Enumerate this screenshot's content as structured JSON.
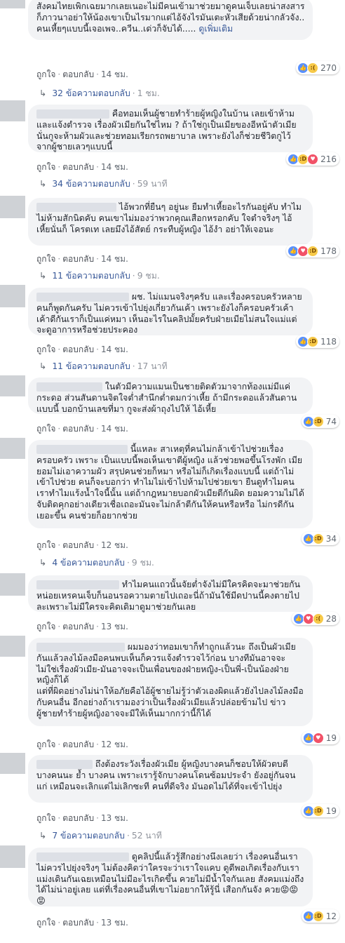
{
  "labels": {
    "like": "ถูกใจ",
    "reply": "ตอบกลับ",
    "dot": "·"
  },
  "comments": [
    {
      "text": "สังคมไทยเพิกเฉยมากเลยเนอะไม่มีคนเข้ามาช่วยมาดูคนเจ็บเลยน่าสงสาร\nก็ภาวนาอย่าให้น้องเขาเป็นไรมากแต่ไอ้จังไรมันเตะหัวเสียด้วยน่ากลัวจัง..\nคนเหี้ยๆแบบนี้เจอเพจ..ควีน..เด่วก็จับได้.....",
      "see_more": "ดูเพิ่มเติม",
      "time": "14 ชม.",
      "reactions": [
        "like",
        "sad"
      ],
      "reaction_count": "270",
      "replies": "32 ข้อความตอบกลับ",
      "replies_time": "1 ชม."
    },
    {
      "text": "คือทอมเห็นผู้ชายทำร้ายผู้หญิงในบ้าน เลยเข้าห้ามและแจ้งตำรวจ เรื่องผัวเมียกันใช่ไหม ? ถ้าใช่กูเป็นเมียของอีหน้าตัวเมียนั่นกูจะห้ามผัวและช่วยทอมเรียกรถพยาบาล เพราะยังไงก็ช่วยชีวิตกูไว้จากผู้ชายเลวๆแบบนี้",
      "time": "14 ชม.",
      "reactions": [
        "like",
        "haha",
        "love"
      ],
      "reaction_count": "216",
      "replies": "34 ข้อความตอบกลับ",
      "replies_time": "59 นาที"
    },
    {
      "text": "ไอ้พวกที่ยืนๆ อยู่นะ ยืมทำเหี้ยอะไรกันอยู่คับ ทำไมไม่ห้ามสักนิดคับ คนเขาไม่มองว่าพวกคุณเสือกหรอกคับ ใจตำจริงๆ ไอ้เหี้ยนั่นก็ โครตเท เลยมึงไอ้สัตย์ กระทืบผู้หญิง ไอ้งำ อย่าให้เจอนะ",
      "time": "14 ชม.",
      "reactions": [
        "like",
        "love",
        "haha"
      ],
      "reaction_count": "178",
      "replies": "11 ข้อความตอบกลับ",
      "replies_time": "9 ชม."
    },
    {
      "text": "ผช. ไม่แมนจริงๆครับ และเรื่องครอบครัวหลายคนก็พูดกันครับ ไม่ควรเข้าไปยุ่งเกี่ยวกันเค้า เพราะยังไงก็ครอบครัวเค้า เค้าดีกันเราก็เป็นแค่หมา เห็นอะไรในคลิปมั้ยครับฝ่ายเมียไม่สนใจแม่แต่จะดูอาการหรือช่วยประคอง",
      "time": "14 ชม.",
      "reactions": [
        "like",
        "haha"
      ],
      "reaction_count": "118",
      "replies": "11 ข้อความตอบกลับ",
      "replies_time": "17 นาที"
    },
    {
      "text": "ในตัวมีความแมนเป็นชายติดตัวมาจากท้องแม่มีแค่กระดอ ส่วนสันดานจิตใจต่ำสำนึกต่ำตมกว่าเหี้ย ถ้ามีกระดอแล้วสันดานแบบนี้ บอกบ้านเลขที่มา กูจะส่งผ้าถุงไปให้ ไอ้เหี้ย",
      "time": "14 ชม.",
      "reactions": [
        "like",
        "haha"
      ],
      "reaction_count": "74"
    },
    {
      "text": "นี้แหละ สาเหตุที่คนไม่กล้าเข้าไปช่วยเรื่องครอบครัว เพราะ เป็นแบบนี้พอเห็นเขาตีผู้หญิง แล้วช่วยพอขึ้นโรงพัก เมียยอมไม่เอาความผัว สรุปคนช่วยก็หมา หรือไม่ก็เกิดเรื่องแบบนี้ แต่ถ้าไม่เข้าไปช่วย คนก็จะบอกว่า ทำไมไม่เข้าไปห้ามไปช่วยเขา ยืนดูทำไมคนเราทำไมแร้งน้ำใจนี้นั้น แต่ถ้ากฎหมายบอกผัวเมียตีกันผิด ยอมความไม่ได้ จับติดคุกอย่างเดียวเชื่อเถอะมันจะไม่กล้าตีกันให้คนหรือหรือ ไม่กรดีกันเยอะขึ้น คนช่วยก็อยากช่วย",
      "time": "12 ชม.",
      "reactions": [
        "like",
        "haha"
      ],
      "reaction_count": "34",
      "replies": "4 ข้อความตอบกลับ",
      "replies_time": "9 ชม."
    },
    {
      "text": "ทำไมคนแถวนั้นจัยต่ำจังไม่มีใครคิดจะมาช่วยกันหน่อยเหรคนเจ็บก็นอนรอความตายไปเถอะนี่ถ้ามันใช้มีดปานนี้คงตายไปละเพราะไม่มีใครจะคิดเดิมาดูมาช่วยกันเลย",
      "time": "13 ชม.",
      "reactions": [
        "like",
        "love",
        "sad"
      ],
      "reaction_count": "28"
    },
    {
      "text": "ผมมองว่าทอมเขาก็ทำถูกแล้วนะ ถึงเป็นผัวเมียกันแล้วลงไม้ลงมือคนพบเห็นก็ควรแจ้งตำรวจไว้ก่อน บางทีมันอาจจะไม่ใช่เรื่องผัวเมีย-มันอาจจะเป็นเพื่อนของฝ่ายหญิง-เป็นพี่-เป็นน้องฝ่ายหญิงก็ได้\nแต่ที่ผิดอย่างไม่น่าให้อภัยคือไอ้ผู้ชายไม่รู้ว่าตัวเองผิดแล้วยังไปลงไม้ลงมือกับคนอื่น อีกอย่างถ้าเรามองว่าเป็นเรื่องผัวเมียแล้วปล่อยข้ามไป ข่าวผู้ชายทำร้ายผู้หญิงอาจจะมีให้เห็นมากกว่านี้ก็ได้",
      "time": "12 ชม.",
      "reactions": [
        "like",
        "love"
      ],
      "reaction_count": "19"
    },
    {
      "text": "ถึงต้องระวังเรื่องผัวเมีย ผู้หญิงบางคนก็ชอบให้ผัวตบตี บางคนนะ ย้ำ บางคน เพราะเรารู้จักบางคนโดนซ้อมประจำ ยังอยู่กันจนแก่ เหมือนจะเลิกแต่ไม่เลิกซะที คนที่ดีจริง มันอดไม่ได้ที่จะเข้าไปยุ่ง",
      "time": "13 ชม.",
      "reactions": [
        "like",
        "haha"
      ],
      "reaction_count": "19",
      "replies": "7 ข้อความตอบกลับ",
      "replies_time": "52 นาที"
    },
    {
      "text": "ดูคลิปนี้แล้วรู้สึกอย่างนึงเลยว่า เรื่องคนอื่นเราไม่ควรไปยุ่งจริงๆ ไม่ต้องคิดว่าใครจะว่าเราใจแคบ ดูดีพอเกิดเรื่องกับเรา แม่งเดินกันเฉยเหมือนไม่มีอะไรเกิดขึ้น ควยไม่มีน้ำใจกันเลย สังคมแม่งถึงได้ไม่น่าอยู่เลย แต่ที่เรื่องคนอื่นที่เขาไม่อยากให้รู้นี่ เสือกกันจัง ควย😡😡😡",
      "time": "13 ชม.",
      "reactions": [
        "like",
        "haha"
      ],
      "reaction_count": "12"
    }
  ]
}
